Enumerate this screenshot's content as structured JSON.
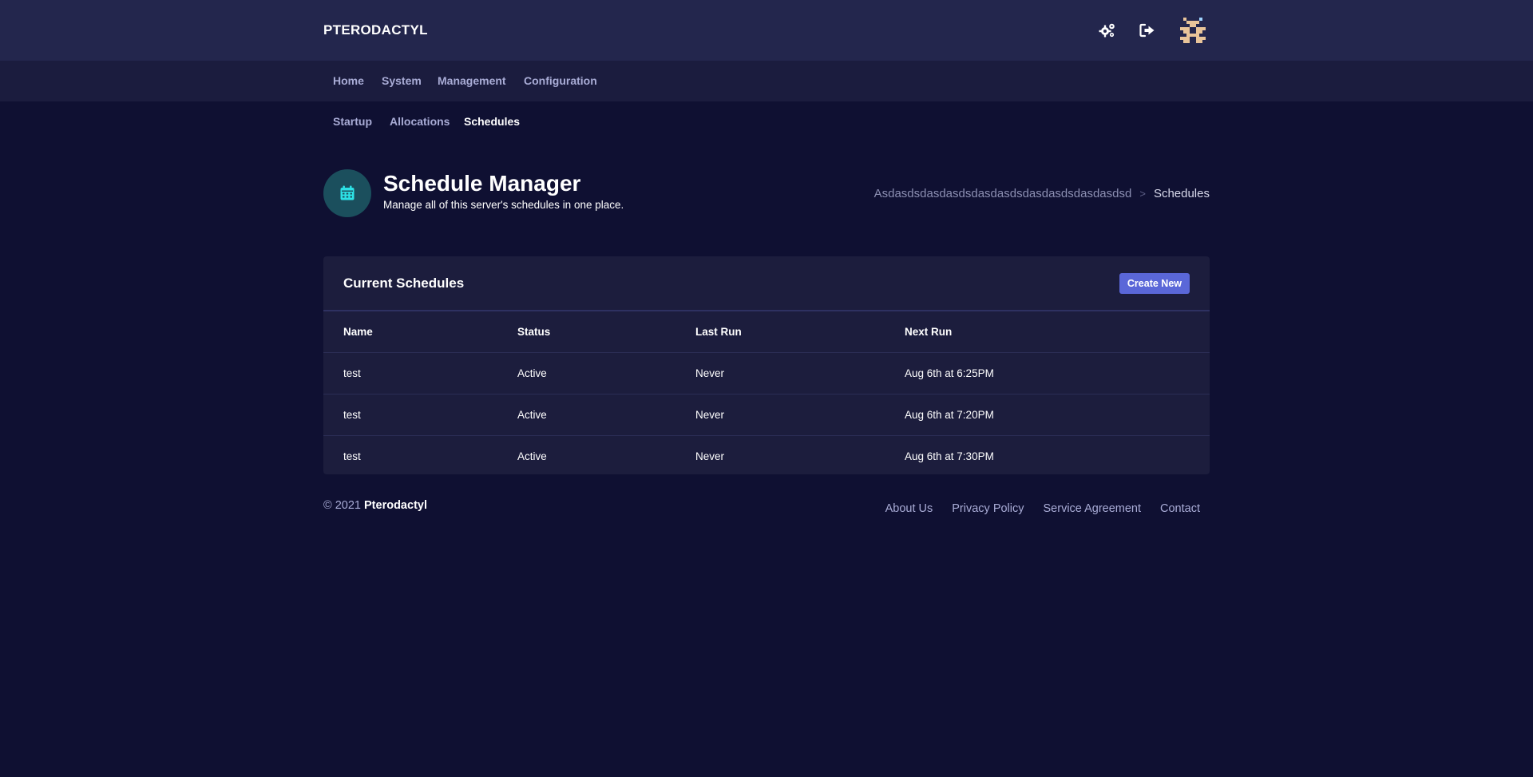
{
  "app": {
    "brand": "PTERODACTYL"
  },
  "topbar": {
    "icons": [
      "settings-icon",
      "logout-icon"
    ],
    "avatar": "user-avatar"
  },
  "nav": {
    "items": [
      {
        "label": "Home"
      },
      {
        "label": "System"
      },
      {
        "label": "Management"
      },
      {
        "label": "Configuration"
      }
    ]
  },
  "subnav": {
    "items": [
      {
        "label": "Startup",
        "active": false
      },
      {
        "label": "Allocations",
        "active": false
      },
      {
        "label": "Schedules",
        "active": true
      }
    ]
  },
  "header": {
    "icon": "calendar-icon",
    "title": "Schedule Manager",
    "subtitle": "Manage all of this server's schedules in one place."
  },
  "breadcrumb": {
    "parent": "Asdasdsdasdasdsdasdasdsdasdasdsdasdasdsd",
    "separator": ">",
    "current": "Schedules"
  },
  "card": {
    "title": "Current Schedules",
    "create_label": "Create New",
    "columns": [
      "Name",
      "Status",
      "Last Run",
      "Next Run"
    ],
    "rows": [
      [
        "test",
        "Active",
        "Never",
        "Aug 6th at 6:25PM"
      ],
      [
        "test",
        "Active",
        "Never",
        "Aug 6th at 7:20PM"
      ],
      [
        "test",
        "Active",
        "Never",
        "Aug 6th at 7:30PM"
      ]
    ]
  },
  "footer": {
    "copyright_prefix": "© 2021",
    "copyright_name": "Pterodactyl",
    "links": [
      "About Us",
      "Privacy Policy",
      "Service Agreement",
      "Contact"
    ]
  },
  "colors": {
    "background": "#0f1032",
    "topbar": "#23264d",
    "navbar": "#1b1c3e",
    "card": "#1c1d3d",
    "accent": "#5a67d8",
    "icon_circle": "#1b4f5d",
    "icon_accent": "#2de2e6"
  }
}
